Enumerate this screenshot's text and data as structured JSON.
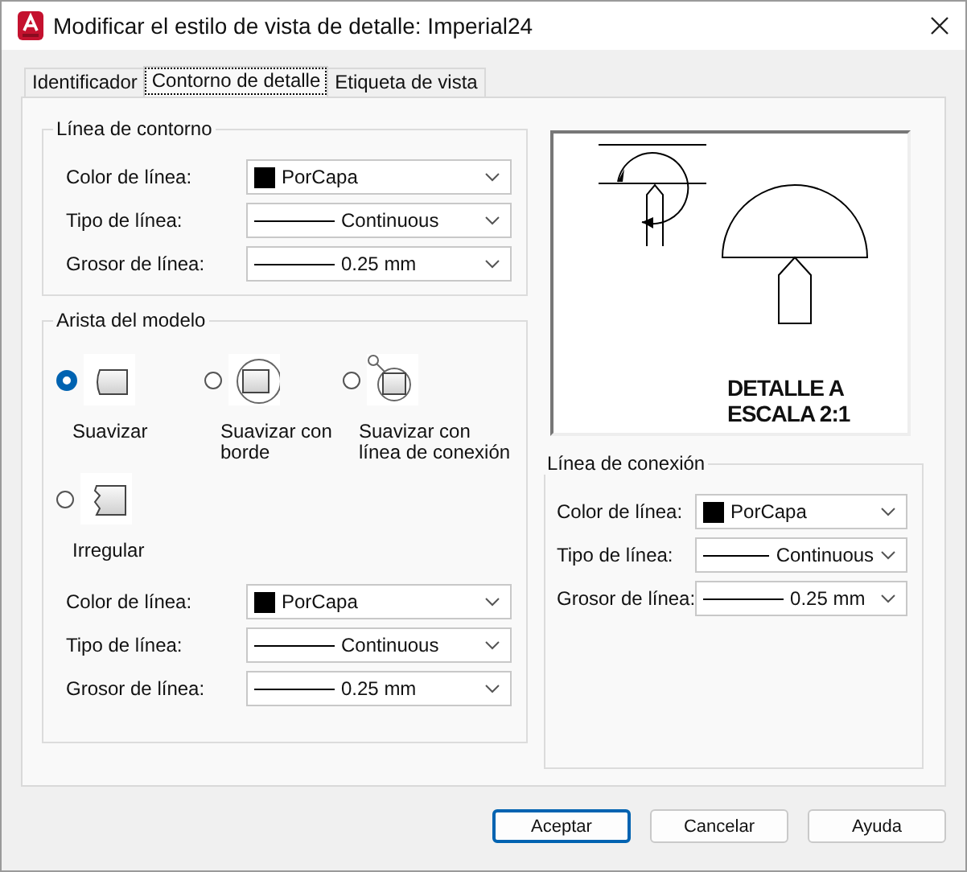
{
  "window": {
    "title": "Modificar el estilo de vista de detalle: Imperial24"
  },
  "tabs": [
    {
      "label": "Identificador",
      "selected": false
    },
    {
      "label": "Contorno de detalle",
      "selected": true
    },
    {
      "label": "Etiqueta de vista",
      "selected": false
    }
  ],
  "boundary_group": {
    "title": "Línea de contorno",
    "fields": [
      {
        "label": "Color de línea:",
        "kind": "color",
        "value": "PorCapa"
      },
      {
        "label": "Tipo de línea:",
        "kind": "linetype",
        "value": "Continuous"
      },
      {
        "label": "Grosor de línea:",
        "kind": "lineweight",
        "value": "0.25 mm"
      }
    ]
  },
  "edge_group": {
    "title": "Arista del modelo",
    "options": [
      {
        "label": "Suavizar",
        "kind": "smooth",
        "selected": true
      },
      {
        "label": "Suavizar con borde",
        "kind": "smooth_border",
        "selected": false
      },
      {
        "label": "Suavizar con línea de conexión",
        "kind": "smooth_connection",
        "selected": false
      },
      {
        "label": "Irregular",
        "kind": "jagged",
        "selected": false
      }
    ],
    "fields": [
      {
        "label": "Color de línea:",
        "kind": "color",
        "value": "PorCapa"
      },
      {
        "label": "Tipo de línea:",
        "kind": "linetype",
        "value": "Continuous"
      },
      {
        "label": "Grosor de línea:",
        "kind": "lineweight",
        "value": "0.25 mm"
      }
    ]
  },
  "preview": {
    "caption": [
      "DETALLE A",
      "ESCALA 2:1"
    ]
  },
  "connection_group": {
    "title": "Línea de conexión",
    "fields": [
      {
        "label": "Color de línea:",
        "kind": "color",
        "value": "PorCapa"
      },
      {
        "label": "Tipo de línea:",
        "kind": "linetype",
        "value": "Continuous"
      },
      {
        "label": "Grosor de línea:",
        "kind": "lineweight",
        "value": "0.25 mm"
      }
    ]
  },
  "buttons": [
    "Aceptar",
    "Cancelar",
    "Ayuda"
  ]
}
